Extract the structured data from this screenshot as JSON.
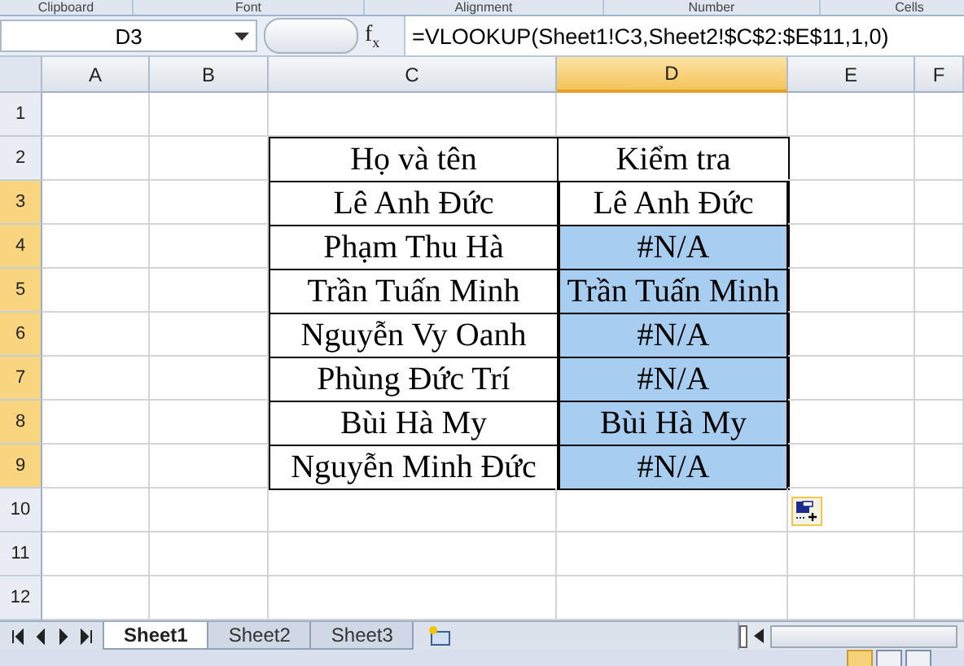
{
  "ribbon_groups": [
    "Clipboard",
    "Font",
    "Alignment",
    "Number",
    "Cells"
  ],
  "formula_bar": {
    "name_box": "D3",
    "fx": "f$_{x}$",
    "formula": "=VLOOKUP(Sheet1!C3,Sheet2!$C$2:$E$11,1,0)"
  },
  "columns": [
    {
      "label": "A",
      "selected": false
    },
    {
      "label": "B",
      "selected": false
    },
    {
      "label": "C",
      "selected": false
    },
    {
      "label": "D",
      "selected": true
    },
    {
      "label": "E",
      "selected": false
    },
    {
      "label": "F",
      "selected": false
    }
  ],
  "rows": [
    {
      "number": "1",
      "cells": []
    },
    {
      "number": "2",
      "cells": [
        {
          "text": "Họ và tên",
          "selected": false
        },
        {
          "text": "Kiểm tra",
          "selected": false
        }
      ]
    },
    {
      "number": "3",
      "cells": [
        {
          "text": "Lê Anh Đức",
          "selected": false
        },
        {
          "text": "Lê Anh Đức",
          "selected": true,
          "active": true
        }
      ]
    },
    {
      "number": "4",
      "cells": [
        {
          "text": "Phạm Thu Hà",
          "selected": false
        },
        {
          "text": "#N/A",
          "selected": true
        }
      ]
    },
    {
      "number": "5",
      "cells": [
        {
          "text": "Trần Tuấn Minh",
          "selected": false
        },
        {
          "text": "Trần Tuấn Minh",
          "selected": true
        }
      ]
    },
    {
      "number": "6",
      "cells": [
        {
          "text": "Nguyễn Vy Oanh",
          "selected": false
        },
        {
          "text": "#N/A",
          "selected": true
        }
      ]
    },
    {
      "number": "7",
      "cells": [
        {
          "text": "Phùng Đức Trí",
          "selected": false
        },
        {
          "text": "#N/A",
          "selected": true
        }
      ]
    },
    {
      "number": "8",
      "cells": [
        {
          "text": "Bùi Hà My",
          "selected": false
        },
        {
          "text": "Bùi Hà My",
          "selected": true
        }
      ]
    },
    {
      "number": "9",
      "cells": [
        {
          "text": "Nguyễn Minh Đức",
          "selected": false
        },
        {
          "text": "#N/A",
          "selected": true
        }
      ]
    },
    {
      "number": "10",
      "cells": []
    },
    {
      "number": "11",
      "cells": []
    },
    {
      "number": "12",
      "cells": []
    }
  ],
  "sheet_tabs": [
    {
      "label": "Sheet1",
      "selected": true
    },
    {
      "label": "Sheet2",
      "selected": false
    },
    {
      "label": "Sheet3",
      "selected": false
    }
  ]
}
